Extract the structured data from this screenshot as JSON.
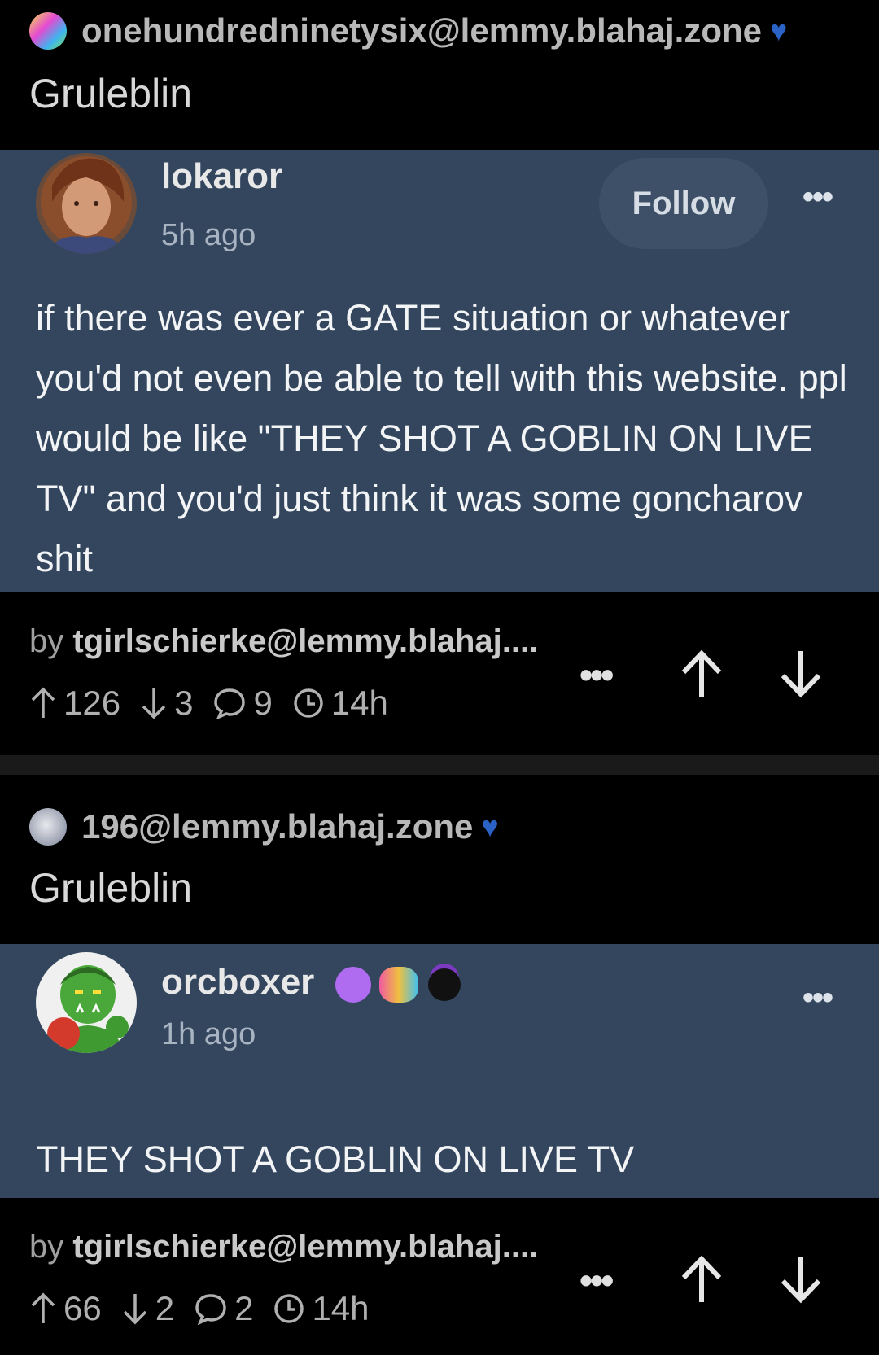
{
  "posts": [
    {
      "community": {
        "name": "onehundredninetysix@lemmy.blahaj.zone",
        "icon": "196-community-icon"
      },
      "title": "Gruleblin",
      "card": {
        "username": "lokaror",
        "time_ago": "5h ago",
        "follow_label": "Follow",
        "more_label": "•••",
        "body": "if there was ever a GATE situation or whatever you'd not even be able to tell with this website. ppl would be like \"THEY SHOT A GOBLIN ON LIVE TV\" and you'd just think it was some goncharov shit"
      },
      "footer": {
        "by_prefix": "by",
        "author": "tgirlschierke@lemmy.blahaj....",
        "upvotes": "126",
        "downvotes": "3",
        "comments": "9",
        "age": "14h",
        "more_label": "•••"
      }
    },
    {
      "community": {
        "name": "196@lemmy.blahaj.zone",
        "icon": "196-community-icon"
      },
      "title": "Gruleblin",
      "card": {
        "username": "orcboxer",
        "time_ago": "1h ago",
        "more_label": "•••",
        "body": "THEY SHOT A GOBLIN ON LIVE TV"
      },
      "footer": {
        "by_prefix": "by",
        "author": "tgirlschierke@lemmy.blahaj....",
        "upvotes": "66",
        "downvotes": "2",
        "comments": "2",
        "age": "14h",
        "more_label": "•••"
      }
    }
  ],
  "colors": {
    "background": "#000000",
    "card": "#33465e",
    "heart": "#2b62c6",
    "divider": "#1a1a1a"
  }
}
